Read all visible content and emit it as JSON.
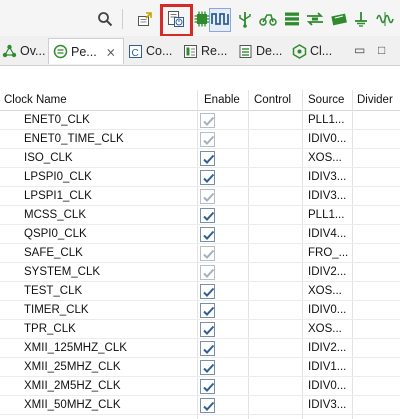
{
  "toolbar": {
    "icons": [
      "search-icon",
      "export-icon",
      "clocks-view-icon",
      "chip-icon",
      "pins-icon",
      "usb-icon",
      "peripherals-list-icon",
      "transfer-icon",
      "dma-icon",
      "power-icon",
      "waveform-icon"
    ]
  },
  "tabs": [
    {
      "label": "Ov...",
      "icon": "overview-icon"
    },
    {
      "label": "Pe...",
      "icon": "peripherals-icon",
      "close": "⨯"
    },
    {
      "label": "Co...",
      "icon": "components-icon"
    },
    {
      "label": "Re...",
      "icon": "registers-icon"
    },
    {
      "label": "De...",
      "icon": "devices-icon"
    },
    {
      "label": "Cl...",
      "icon": "clocks-icon"
    }
  ],
  "window_controls": {
    "minimize": "▭",
    "maximize": "□"
  },
  "table": {
    "columns": [
      "Clock Name",
      "Enable",
      "Control",
      "Source",
      "Divider"
    ],
    "rows": [
      {
        "name": "ENET0_CLK",
        "enabled": true,
        "editable": false,
        "source": "PLL1..."
      },
      {
        "name": "ENET0_TIME_CLK",
        "enabled": true,
        "editable": false,
        "source": "IDIV0..."
      },
      {
        "name": "ISO_CLK",
        "enabled": true,
        "editable": true,
        "source": "XOS..."
      },
      {
        "name": "LPSPI0_CLK",
        "enabled": true,
        "editable": true,
        "source": "IDIV3..."
      },
      {
        "name": "LPSPI1_CLK",
        "enabled": true,
        "editable": false,
        "source": "IDIV3..."
      },
      {
        "name": "MCSS_CLK",
        "enabled": true,
        "editable": true,
        "source": "PLL1..."
      },
      {
        "name": "QSPI0_CLK",
        "enabled": true,
        "editable": true,
        "source": "IDIV4..."
      },
      {
        "name": "SAFE_CLK",
        "enabled": true,
        "editable": false,
        "source": "FRO_..."
      },
      {
        "name": "SYSTEM_CLK",
        "enabled": true,
        "editable": false,
        "source": "IDIV2..."
      },
      {
        "name": "TEST_CLK",
        "enabled": true,
        "editable": true,
        "source": "XOS..."
      },
      {
        "name": "TIMER_CLK",
        "enabled": true,
        "editable": true,
        "source": "IDIV0..."
      },
      {
        "name": "TPR_CLK",
        "enabled": true,
        "editable": true,
        "source": "XOS..."
      },
      {
        "name": "XMII_125MHZ_CLK",
        "enabled": true,
        "editable": true,
        "source": "IDIV2..."
      },
      {
        "name": "XMII_25MHZ_CLK",
        "enabled": true,
        "editable": true,
        "source": "IDIV1..."
      },
      {
        "name": "XMII_2M5HZ_CLK",
        "enabled": true,
        "editable": true,
        "source": "IDIV0..."
      },
      {
        "name": "XMII_50MHZ_CLK",
        "enabled": true,
        "editable": true,
        "source": "IDIV3..."
      }
    ]
  },
  "colors": {
    "highlight_box": "#d42a2a",
    "accent_green": "#2e8b2e",
    "check_blue": "#2f5f95"
  }
}
